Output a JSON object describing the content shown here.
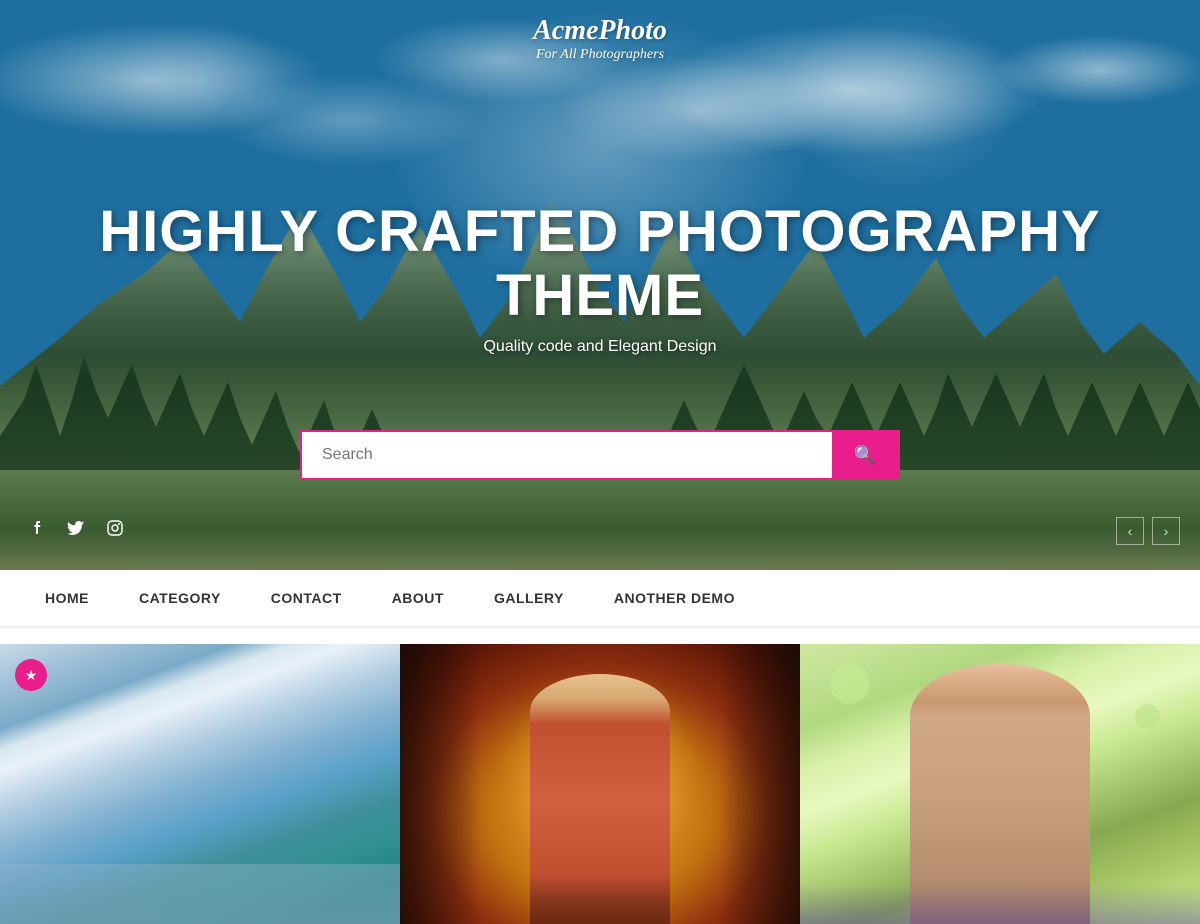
{
  "site": {
    "logo_title": "AcmePhoto",
    "logo_subtitle": "For All Photographers"
  },
  "hero": {
    "title": "HIGHLY CRAFTED PHOTOGRAPHY THEME",
    "subtitle": "Quality code and Elegant Design",
    "overlay_color": "rgba(0,0,0,0.1)"
  },
  "search": {
    "placeholder": "Search",
    "button_icon": "🔍"
  },
  "social": {
    "facebook": "f",
    "twitter": "t",
    "instagram": "ig"
  },
  "slider": {
    "prev_label": "‹",
    "next_label": "›"
  },
  "nav": {
    "items": [
      {
        "id": "home",
        "label": "HOME"
      },
      {
        "id": "category",
        "label": "CATEGORY"
      },
      {
        "id": "contact",
        "label": "CONTACT"
      },
      {
        "id": "about",
        "label": "ABOUT"
      },
      {
        "id": "gallery",
        "label": "GALLERY"
      },
      {
        "id": "another-demo",
        "label": "ANOTHER DEMO"
      }
    ]
  },
  "photos": [
    {
      "id": "photo-1",
      "has_star": true,
      "star_label": "★",
      "alt": "Girl near river in blue outfit"
    },
    {
      "id": "photo-2",
      "has_star": false,
      "alt": "Girl with cards in warm golden light"
    },
    {
      "id": "photo-3",
      "has_star": false,
      "alt": "Girl in natural green setting"
    }
  ],
  "colors": {
    "accent": "#e91e8c",
    "nav_text": "#333333",
    "hero_overlay": "rgba(0,0,0,0.05)"
  }
}
